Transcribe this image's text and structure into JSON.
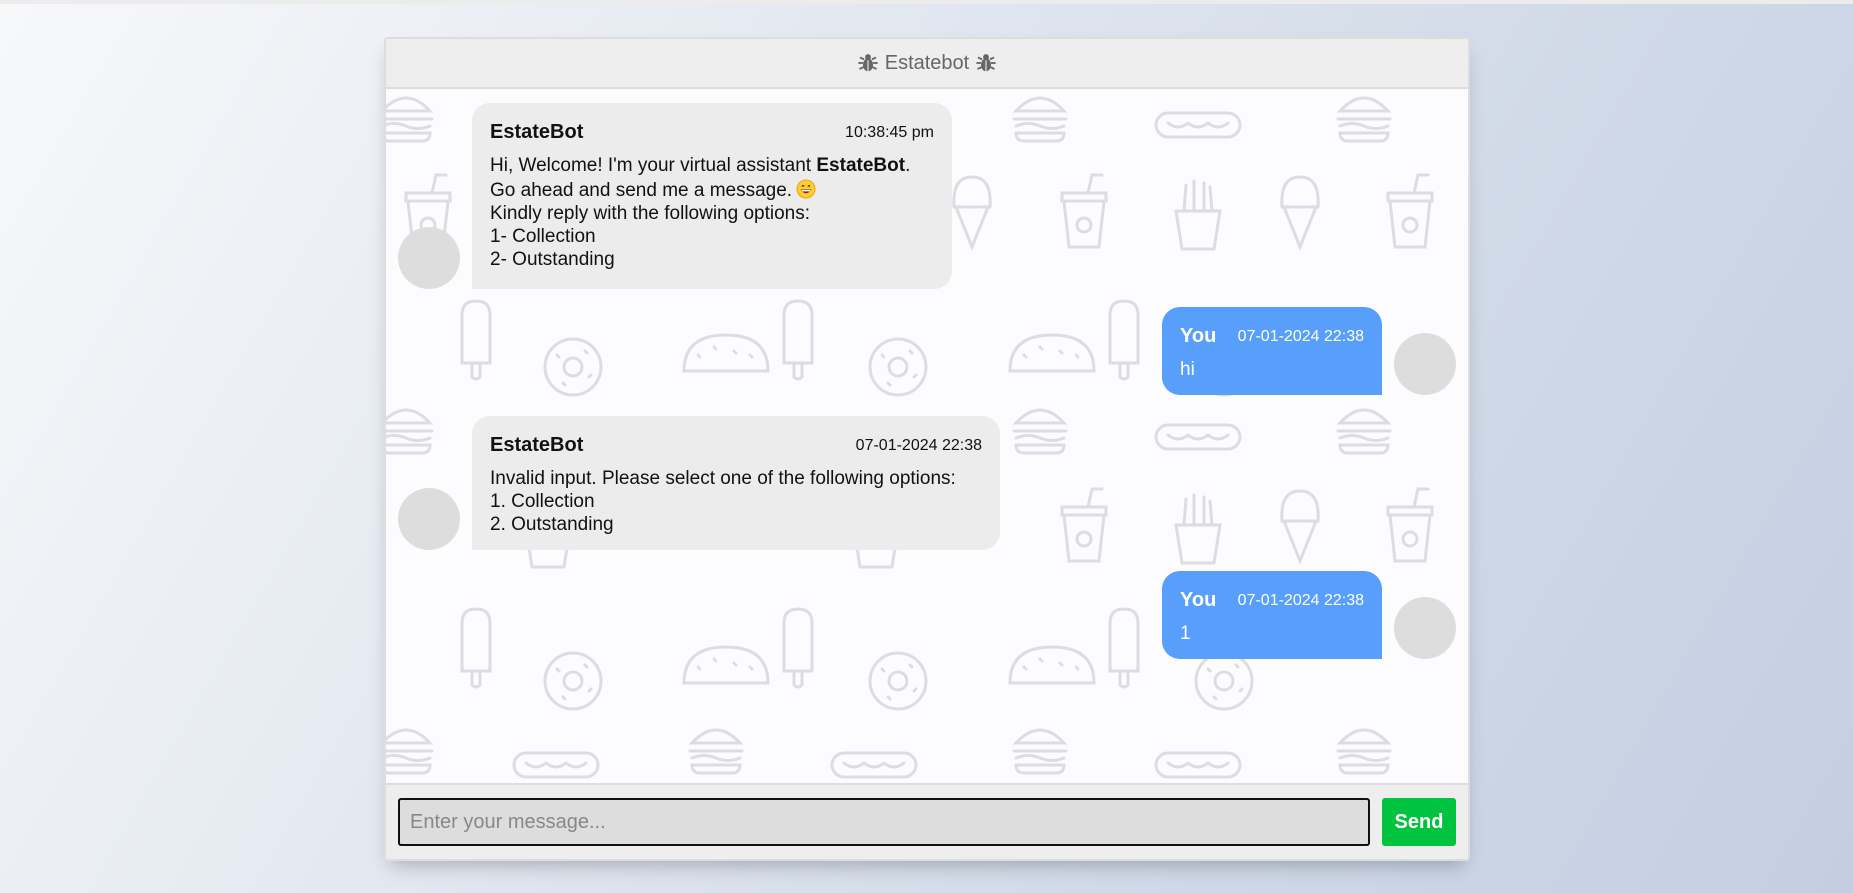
{
  "header": {
    "title": "Estatebot",
    "left_icon": "bug-icon",
    "right_icon": "bug-icon"
  },
  "messages": [
    {
      "sender": "EstateBot",
      "time": "10:38:45 pm",
      "side": "left",
      "line1_prefix": "Hi, Welcome! I'm your virtual assistant ",
      "line1_bold": "EstateBot",
      "line1_suffix": ".",
      "line2": "Go ahead and send me a message.",
      "line2_icon": "grinning-face-emoji",
      "line3": "Kindly reply with the following options:",
      "line4": "1- Collection",
      "line5": "2- Outstanding"
    },
    {
      "sender": "You",
      "time": "07-01-2024 22:38",
      "side": "right",
      "text": "hi"
    },
    {
      "sender": "EstateBot",
      "time": "07-01-2024 22:38",
      "side": "left",
      "line1": "Invalid input. Please select one of the following options:",
      "line2": "1. Collection",
      "line3": "2. Outstanding"
    },
    {
      "sender": "You",
      "time": "07-01-2024 22:38",
      "side": "right",
      "text": "1"
    }
  ],
  "input": {
    "placeholder": "Enter your message...",
    "value": ""
  },
  "send_button": {
    "label": "Send"
  },
  "colors": {
    "bot_bubble": "#ececec",
    "user_bubble": "#579ffb",
    "send_button": "#00c43f",
    "header_bg": "#eeeeee",
    "avatar": "#dddddd"
  }
}
